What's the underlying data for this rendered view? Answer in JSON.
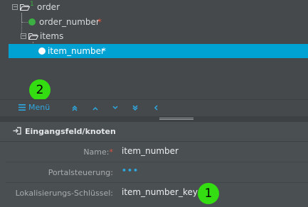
{
  "tree": {
    "nodes": [
      {
        "label": "order",
        "superscript": "1"
      },
      {
        "label": "order_number",
        "required_mark": "*"
      },
      {
        "label": "items"
      },
      {
        "label": "item_number",
        "required_mark": "*",
        "selected": true
      }
    ]
  },
  "toolbar": {
    "menu_label": "Menü",
    "menu_icon": "hamburger-icon",
    "nav_icons": [
      "double-chevron-up-icon",
      "chevron-up-icon",
      "chevron-down-icon",
      "double-chevron-down-icon",
      "chevron-left-icon"
    ]
  },
  "annotations": {
    "badge_1": "1",
    "badge_2": "2",
    "badge_color": "#33dd11"
  },
  "panel": {
    "title": "Eingangsfeld/knoten",
    "title_icon": "sign-in-icon"
  },
  "form": {
    "name_label": "Name:",
    "name_required": "*",
    "name_value": "item_number",
    "portal_label": "Portalsteuerung:",
    "portal_value": "•••",
    "key_label": "Lokalisierungs-Schlüssel:",
    "key_value": "item_number_key"
  },
  "colors": {
    "accent": "#2ea8e0",
    "selection": "#00a2d3",
    "required": "#e0533d",
    "node_green": "#3cb043"
  }
}
